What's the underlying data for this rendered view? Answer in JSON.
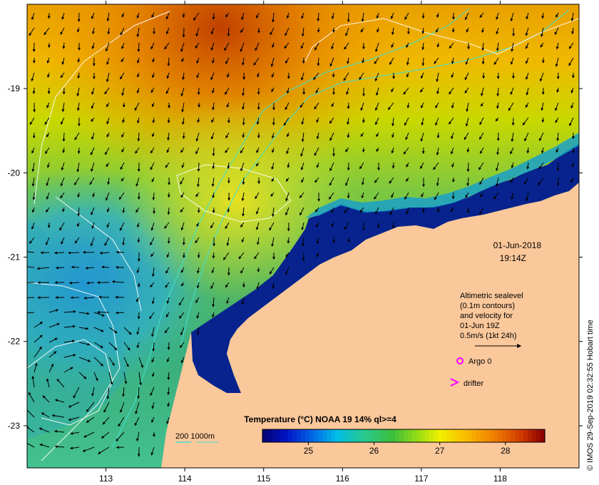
{
  "map": {
    "lon_ticks": [
      "113",
      "114",
      "115",
      "116",
      "117",
      "118"
    ],
    "lat_ticks": [
      "-19",
      "-20",
      "-21",
      "-22",
      "-23"
    ],
    "lon_range": [
      112.0,
      119.0
    ],
    "lat_range": [
      -23.5,
      -18.0
    ]
  },
  "timestamp": {
    "date": "01-Jun-2018",
    "time": "19:14Z"
  },
  "legend": {
    "line1": "Altimetric sealevel",
    "line2": "(0.1m contours)",
    "line3": "and velocity for",
    "line4": "01-Jun 19Z",
    "line5": "0.5m/s (1kt 24h)",
    "argo_label": "Argo 0",
    "drifter_label": "drifter",
    "bathy_label": "200  1000m"
  },
  "colorbar": {
    "title": "Temperature (°C) NOAA 19 14% ql>=4",
    "ticks": [
      "25",
      "26",
      "27",
      "28"
    ],
    "range": [
      24.3,
      28.6
    ]
  },
  "credit": "© IMOS 29-Sep-2019 02:32:55 Hobart time",
  "colors": {
    "land": "#fbc89b",
    "argo": "#ff00ff",
    "drifter": "#ff00ff",
    "bathy": "#40e0d0",
    "contour": "#ffffff"
  }
}
